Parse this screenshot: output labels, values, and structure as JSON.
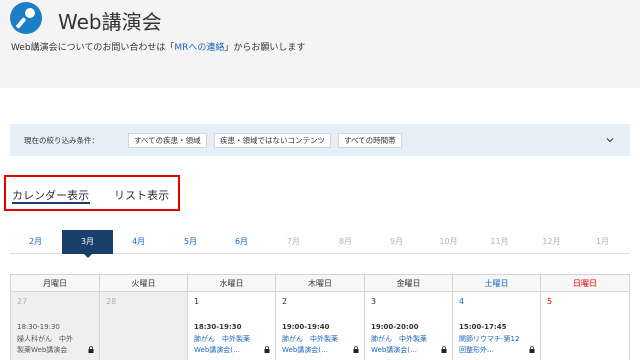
{
  "header": {
    "title": "Web講演会",
    "note_prefix": "Web講演会についてのお問い合わせは「",
    "note_link": "MRへの連絡",
    "note_suffix": "」からお願いします"
  },
  "filter": {
    "label": "現在の絞り込み条件：",
    "chips": [
      "すべての疾患・領域",
      "疾患・領域ではないコンテンツ",
      "すべての時間帯"
    ]
  },
  "tabs": {
    "calendar": "カレンダー表示",
    "list": "リスト表示"
  },
  "months": [
    {
      "label": "2月",
      "state": "enabled"
    },
    {
      "label": "3月",
      "state": "active"
    },
    {
      "label": "4月",
      "state": "enabled"
    },
    {
      "label": "5月",
      "state": "enabled"
    },
    {
      "label": "6月",
      "state": "enabled"
    },
    {
      "label": "7月",
      "state": "disabled"
    },
    {
      "label": "8月",
      "state": "disabled"
    },
    {
      "label": "9月",
      "state": "disabled"
    },
    {
      "label": "10月",
      "state": "disabled"
    },
    {
      "label": "11月",
      "state": "disabled"
    },
    {
      "label": "12月",
      "state": "disabled"
    },
    {
      "label": "1月",
      "state": "disabled"
    }
  ],
  "weekdays": [
    "月曜日",
    "火曜日",
    "水曜日",
    "木曜日",
    "金曜日",
    "土曜日",
    "日曜日"
  ],
  "days": [
    {
      "num": "27",
      "past": true,
      "time": "18:30-19:30",
      "line1": "婦人科がん　中外",
      "line2": "製薬Web講演会",
      "lock": true
    },
    {
      "num": "28",
      "past": true
    },
    {
      "num": "1",
      "time": "18:30-19:30",
      "line1": "肺がん　中外製薬",
      "line2": "Web講演会(…",
      "lock": true
    },
    {
      "num": "2",
      "time": "19:00-19:40",
      "line1": "肺がん　中外製薬",
      "line2": "Web講演会(…",
      "lock": true
    },
    {
      "num": "3",
      "time": "19:00-20:00",
      "line1": "肺がん　中外製薬",
      "line2": "Web講演会(…",
      "lock": true
    },
    {
      "num": "4",
      "time": "15:00-17:45",
      "line1": "関節リウマチ-第12",
      "line2": "回整形外…",
      "lock": true
    },
    {
      "num": "5"
    }
  ],
  "colors": {
    "accent": "#1a3f6b",
    "link": "#1a66b8",
    "highlight": "#e60000"
  }
}
